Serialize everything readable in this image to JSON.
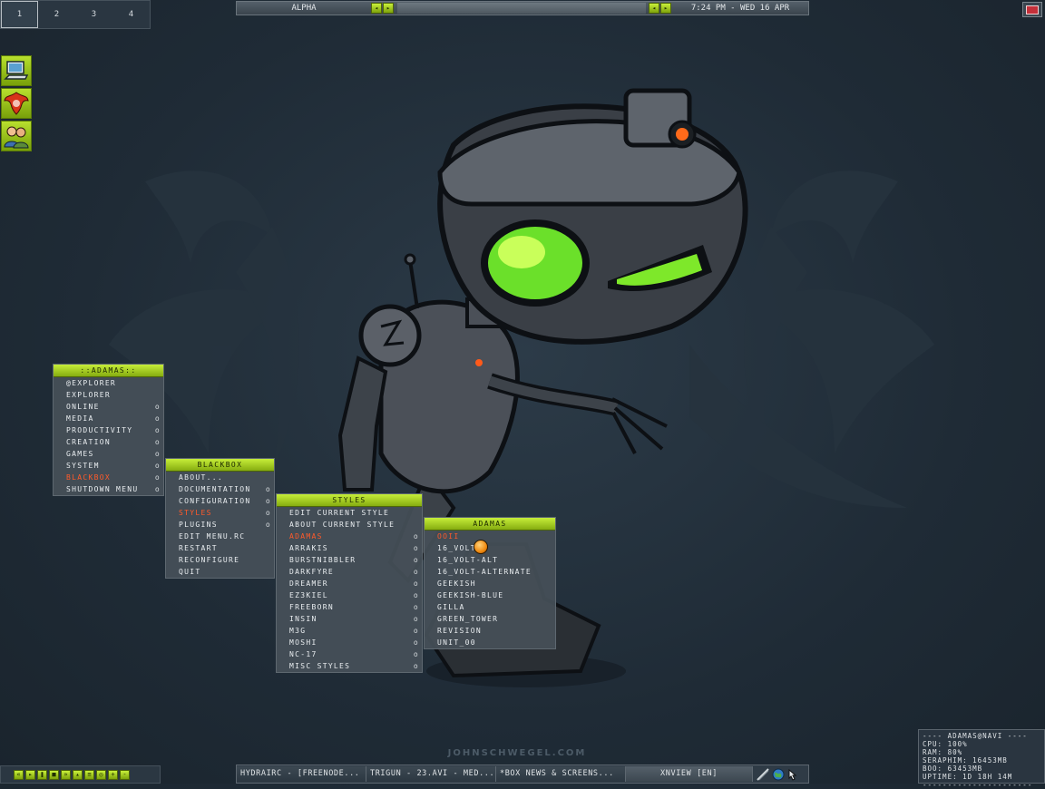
{
  "desktop": {
    "pager": {
      "workspaces": [
        "1",
        "2",
        "3",
        "4"
      ],
      "active": 0
    },
    "toolbar": {
      "workspace_name": "ALPHA",
      "prev": "◂",
      "next": "▸",
      "clock": "7:24 PM - WED 16 APR"
    },
    "signature": "JOHNSCHWEGEL.COM",
    "launchers": [
      {
        "name": "computer-icon"
      },
      {
        "name": "phoenix-icon"
      },
      {
        "name": "users-icon"
      }
    ]
  },
  "menus": {
    "root": {
      "title": "::ADAMAS::",
      "items": [
        {
          "label": "@EXPLORER",
          "sub": ""
        },
        {
          "label": "EXPLORER",
          "sub": ""
        },
        {
          "label": "ONLINE",
          "sub": "o"
        },
        {
          "label": "MEDIA",
          "sub": "o"
        },
        {
          "label": "PRODUCTIVITY",
          "sub": "o"
        },
        {
          "label": "CREATION",
          "sub": "o"
        },
        {
          "label": "GAMES",
          "sub": "o"
        },
        {
          "label": "SYSTEM",
          "sub": "o"
        },
        {
          "label": "BLACKBOX",
          "sub": "o"
        },
        {
          "label": "SHUTDOWN MENU",
          "sub": "o"
        }
      ],
      "selected": 8
    },
    "blackbox": {
      "title": "BLACKBOX",
      "items": [
        {
          "label": "ABOUT...",
          "sub": ""
        },
        {
          "label": "DOCUMENTATION",
          "sub": "o"
        },
        {
          "label": "CONFIGURATION",
          "sub": "o"
        },
        {
          "label": "STYLES",
          "sub": "o"
        },
        {
          "label": "PLUGINS",
          "sub": "o"
        },
        {
          "label": "EDIT MENU.RC",
          "sub": ""
        },
        {
          "label": "RESTART",
          "sub": ""
        },
        {
          "label": "RECONFIGURE",
          "sub": ""
        },
        {
          "label": "QUIT",
          "sub": ""
        }
      ],
      "selected": 3
    },
    "styles": {
      "title": "STYLES",
      "items": [
        {
          "label": "EDIT CURRENT STYLE",
          "sub": ""
        },
        {
          "label": "ABOUT CURRENT STYLE",
          "sub": ""
        },
        {
          "label": "ADAMAS",
          "sub": "o"
        },
        {
          "label": "ARRAKIS",
          "sub": "o"
        },
        {
          "label": "BURSTNIBBLER",
          "sub": "o"
        },
        {
          "label": "DARKFYRE",
          "sub": "o"
        },
        {
          "label": "DREAMER",
          "sub": "o"
        },
        {
          "label": "EZ3KIEL",
          "sub": "o"
        },
        {
          "label": "FREEBORN",
          "sub": "o"
        },
        {
          "label": "INSIN",
          "sub": "o"
        },
        {
          "label": "M3G",
          "sub": "o"
        },
        {
          "label": "MOSHI",
          "sub": "o"
        },
        {
          "label": "NC-17",
          "sub": "o"
        },
        {
          "label": "MISC STYLES",
          "sub": "o"
        }
      ],
      "selected": 2
    },
    "adamas": {
      "title": "ADAMAS",
      "items": [
        {
          "label": "OOII",
          "sub": ""
        },
        {
          "label": "16_VOLT",
          "sub": ""
        },
        {
          "label": "16_VOLT-ALT",
          "sub": ""
        },
        {
          "label": "16_VOLT-ALTERNATE",
          "sub": ""
        },
        {
          "label": "GEEKISH",
          "sub": ""
        },
        {
          "label": "GEEKISH-BLUE",
          "sub": ""
        },
        {
          "label": "GILLA",
          "sub": ""
        },
        {
          "label": "GREEN_TOWER",
          "sub": ""
        },
        {
          "label": "REVISION",
          "sub": ""
        },
        {
          "label": "UNIT_00",
          "sub": ""
        }
      ],
      "selected": 0
    }
  },
  "mediabar": {
    "buttons": [
      {
        "name": "rewind-button",
        "glyph": "«"
      },
      {
        "name": "play-button",
        "glyph": "▸"
      },
      {
        "name": "pause-button",
        "glyph": "❚"
      },
      {
        "name": "stop-button",
        "glyph": "■"
      },
      {
        "name": "forward-button",
        "glyph": "»"
      },
      {
        "name": "eject-button",
        "glyph": "▴"
      },
      {
        "name": "playlist-button",
        "glyph": "≡"
      },
      {
        "name": "settings-button",
        "glyph": "◎"
      },
      {
        "name": "volume-up-button",
        "glyph": "+"
      },
      {
        "name": "volume-down-button",
        "glyph": "-"
      }
    ]
  },
  "taskbar": {
    "tasks": [
      {
        "label": "HYDRAIRC - [FREENODE..."
      },
      {
        "label": "TRIGUN - 23.AVI - MED..."
      },
      {
        "label": "*BOX NEWS & SCREENS..."
      },
      {
        "label": "XNVIEW [EN]"
      }
    ],
    "active": 3,
    "tray": [
      "network-icon",
      "globe-icon",
      "mouse-icon"
    ]
  },
  "sysinfo": {
    "lines": [
      "---- ADAMAS@NAVI ----",
      "CPU: 100%",
      "RAM: 80%",
      "SERAPHIM: 16453MB",
      "BOO: 63453MB",
      "UPTIME: 1D 18H 14M",
      "----------------------"
    ]
  },
  "colors": {
    "accent": "#a8d21f",
    "highlight": "#ff5a2a",
    "background": "#1f2b36"
  }
}
